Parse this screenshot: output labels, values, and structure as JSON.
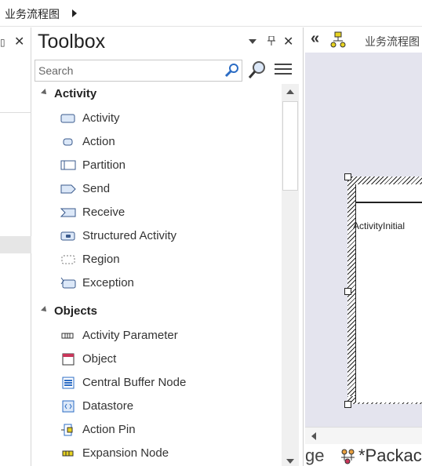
{
  "breadcrumb": {
    "text": "业务流程图"
  },
  "toolbox": {
    "title": "Toolbox",
    "search_placeholder": "Search",
    "groups": [
      {
        "label": "Activity",
        "items": [
          {
            "label": "Activity",
            "icon": "activity-icon"
          },
          {
            "label": "Action",
            "icon": "action-icon"
          },
          {
            "label": "Partition",
            "icon": "partition-icon"
          },
          {
            "label": "Send",
            "icon": "send-icon"
          },
          {
            "label": "Receive",
            "icon": "receive-icon"
          },
          {
            "label": "Structured Activity",
            "icon": "structured-activity-icon"
          },
          {
            "label": "Region",
            "icon": "region-icon"
          },
          {
            "label": "Exception",
            "icon": "exception-icon"
          }
        ]
      },
      {
        "label": "Objects",
        "items": [
          {
            "label": "Activity Parameter",
            "icon": "activity-parameter-icon"
          },
          {
            "label": "Object",
            "icon": "object-icon"
          },
          {
            "label": "Central Buffer Node",
            "icon": "central-buffer-node-icon"
          },
          {
            "label": "Datastore",
            "icon": "datastore-icon"
          },
          {
            "label": "Action Pin",
            "icon": "action-pin-icon"
          },
          {
            "label": "Expansion Node",
            "icon": "expansion-node-icon"
          }
        ]
      }
    ]
  },
  "diagram": {
    "name": "业务流程图",
    "partition_label": "ActivityInitial",
    "tabs": {
      "partial_label": "ge",
      "package_label": "*Packac"
    }
  },
  "colors": {
    "canvas": "#e4e4ee",
    "accent_blue": "#2b6cc4",
    "icon_fill": "#dce8f8"
  }
}
